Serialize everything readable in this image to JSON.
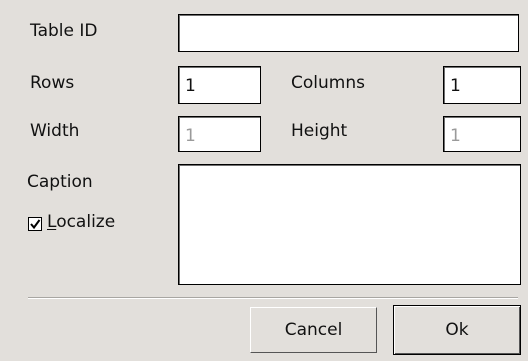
{
  "form": {
    "table_id": {
      "label": "Table ID",
      "value": ""
    },
    "rows": {
      "label": "Rows",
      "value": "1"
    },
    "columns": {
      "label": "Columns",
      "value": "1"
    },
    "width": {
      "label": "Width",
      "value": "1",
      "disabled": true
    },
    "height": {
      "label": "Height",
      "value": "1",
      "disabled": true
    },
    "caption": {
      "label": "Caption",
      "value": ""
    },
    "localize": {
      "mnemonic": "L",
      "label_rest": "ocalize",
      "checked": true
    }
  },
  "buttons": {
    "cancel": "Cancel",
    "ok": "Ok"
  }
}
